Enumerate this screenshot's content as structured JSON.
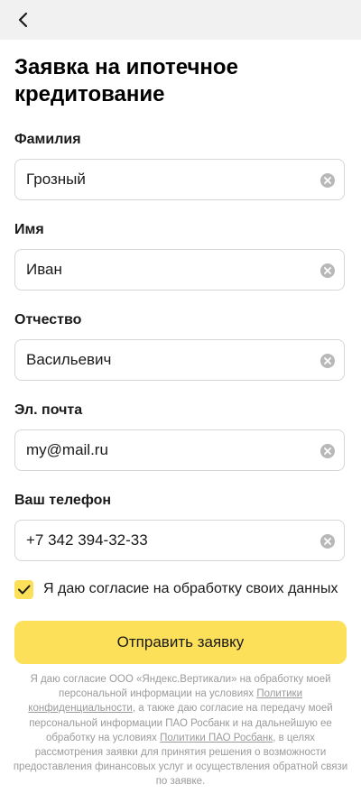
{
  "header": {
    "back_icon": "chevron-left-icon"
  },
  "title": "Заявка на ипотечное кредитование",
  "fields": [
    {
      "label": "Фамилия",
      "value": "Грозный"
    },
    {
      "label": "Имя",
      "value": "Иван"
    },
    {
      "label": "Отчество",
      "value": "Васильевич"
    },
    {
      "label": "Эл. почта",
      "value": "my@mail.ru"
    },
    {
      "label": "Ваш телефон",
      "value": "+7 342 394-32-33"
    }
  ],
  "clear_icon": "clear-circle-icon",
  "consent": {
    "checked": true,
    "label": "Я даю согласие на обработку своих данных"
  },
  "submit_label": "Отправить заявку",
  "legal": {
    "part1": "Я даю согласие ООО «Яндекс.Вертикали» на обработку моей персональной информации на условиях",
    "link1": "Политики конфиденциальности",
    "part2": ", а также даю согласие на передачу моей персональной информации ПАО Росбанк и на дальнейшую ее обработку на условиях",
    "link2": "Политики ПАО Росбанк",
    "part3": ", в целях рассмотрения заявки для принятия решения о возможности предоставления финансовых услуг и осуществления обратной связи по заявке."
  },
  "colors": {
    "accent": "#fde059",
    "topbar": "#f1f1f1",
    "border": "#d6d6d6",
    "muted_text": "#9a9a9a"
  }
}
